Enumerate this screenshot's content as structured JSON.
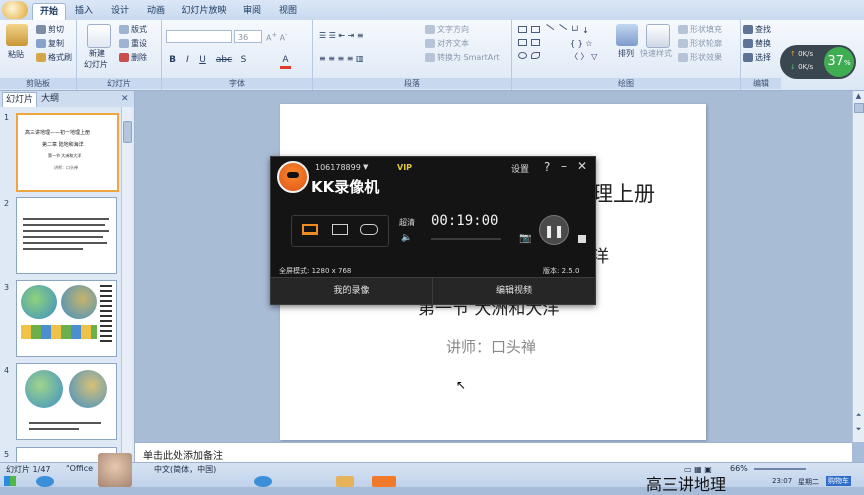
{
  "ribbon": {
    "tabs": [
      "开始",
      "插入",
      "设计",
      "动画",
      "幻灯片放映",
      "审阅",
      "视图"
    ],
    "clipboard": {
      "paste": "粘贴",
      "cut": "剪切",
      "copy": "复制",
      "format_painter": "格式刷",
      "label": "剪贴板"
    },
    "slides": {
      "new_slide_line1": "新建",
      "new_slide_line2": "幻灯片",
      "layout": "版式",
      "reset": "重设",
      "delete": "删除",
      "label": "幻灯片"
    },
    "font": {
      "font_size": "36",
      "label": "字体",
      "bold": "B",
      "italic": "I",
      "underline": "U",
      "shadow": "S",
      "strike": "abc"
    },
    "paragraph": {
      "text_direction": "文字方向",
      "align_text": "对齐文本",
      "convert_smartart": "转换为 SmartArt",
      "label": "段落"
    },
    "drawing": {
      "arrange": "排列",
      "quick_styles": "快速样式",
      "shape_fill": "形状填充",
      "shape_outline": "形状轮廓",
      "shape_effects": "形状效果",
      "label": "绘图"
    },
    "editing": {
      "find": "查找",
      "replace": "替换",
      "select": "选择",
      "label": "编辑"
    }
  },
  "speed_widget": {
    "up": "0K/s",
    "down": "0K/s",
    "percent": "37",
    "percent_sign": "%"
  },
  "left_panel": {
    "tab_slides": "幻灯片",
    "tab_outline": "大纲",
    "thumbs": [
      {
        "num": "1",
        "title": "高三讲地理——初一地理上册",
        "sub1": "第二章 陆地和海洋",
        "sub2": "第一节 大洲和大洋",
        "sub3": "讲师：口头禅"
      },
      {
        "num": "2"
      },
      {
        "num": "3"
      },
      {
        "num": "4"
      },
      {
        "num": "5"
      }
    ]
  },
  "slide": {
    "title_fragment": "理上册",
    "sub_fragment": "洋",
    "line3": "第一节 大洲和大洋",
    "lecturer": "讲师：口头禅"
  },
  "notes": {
    "placeholder": "单击此处添加备注"
  },
  "recorder": {
    "user_id": "106178899",
    "vip": "VIP",
    "settings": "设置",
    "help": "?",
    "app_name": "KK录像机",
    "quality": "超清",
    "timer": "00:19:00",
    "fullscreen_mode": "全屏模式: 1280 x 768",
    "version": "版本: 2.5.0",
    "my_recordings": "我的录像",
    "edit_video": "编辑视频"
  },
  "status": {
    "slide_count": "幻灯片 1/47",
    "theme": "\"Office",
    "language": "中文(简体，中国)",
    "zoom": "66%",
    "overlay_text": "高三讲地理",
    "clock": "23:07",
    "weekday": "星期二",
    "ime": "购物车"
  }
}
